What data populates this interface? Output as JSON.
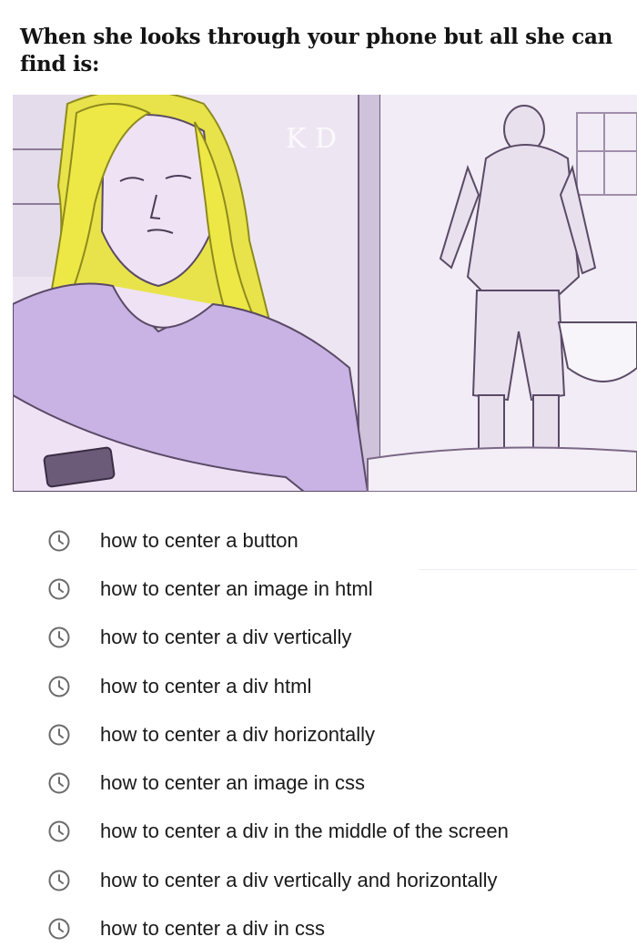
{
  "caption": "When she looks through your phone but all she can find is:",
  "illustration": {
    "watermark": "K D",
    "colors": {
      "hair": "#e8e34a",
      "shirt": "#c9b2e4",
      "skin": "#efe2f4",
      "wall": "#ebe3f1",
      "lines": "#5a4a66"
    }
  },
  "history": {
    "icon": "history-clock-icon",
    "items": [
      "how to center a button",
      "how to center an image in html",
      "how to center a div vertically",
      "how to center a div html",
      "how to center a div horizontally",
      "how to center an image in css",
      "how to center a div in the middle of the screen",
      "how to center a div vertically and horizontally",
      "how to center a div in css"
    ]
  }
}
